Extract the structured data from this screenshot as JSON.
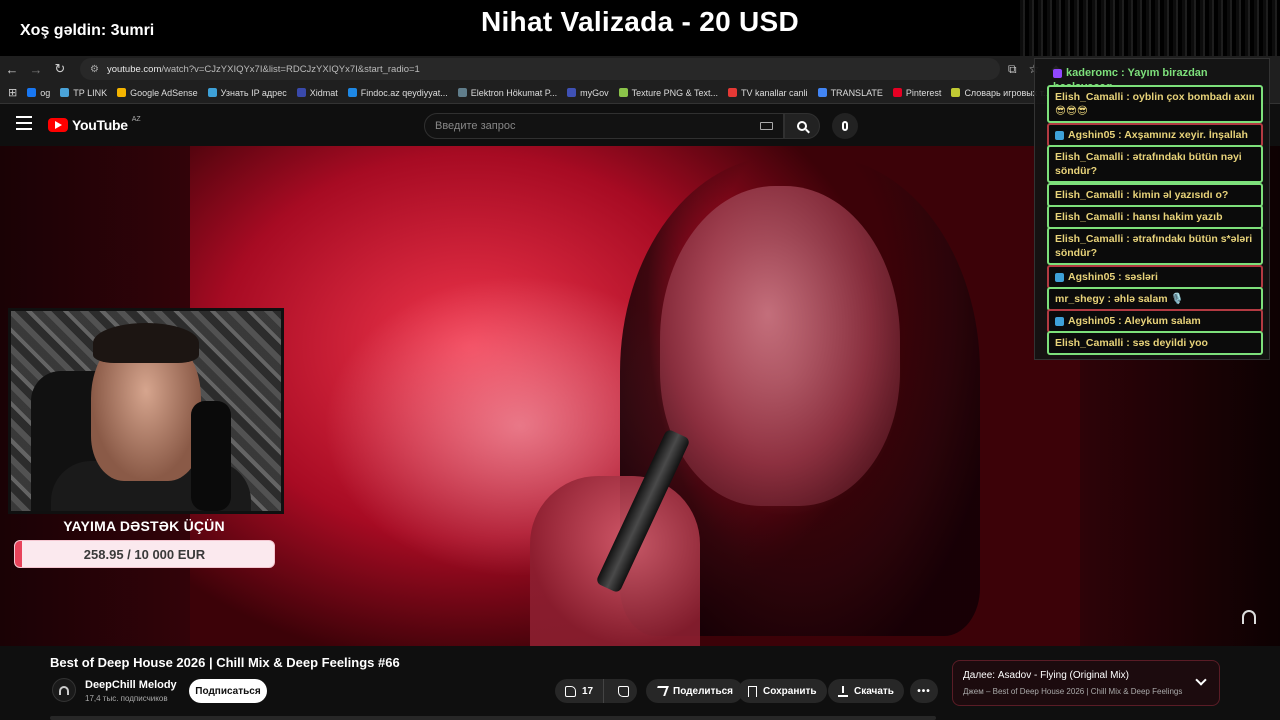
{
  "overlay": {
    "welcome": "Xoş gəldin: 3umri",
    "donation_headline": "Nihat Valizada - 20 USD",
    "support_title": "YAYIMA DƏSTƏK ÜÇÜN",
    "support_amount": "258.95 / 10 000 EUR",
    "support_progress": 0.0259,
    "accent_color": "#e8435b"
  },
  "browser": {
    "url_host": "youtube.com",
    "url_path": "/watch?v=CJzYXIQYx7I&list=RDCJzYXIQYx7I&start_radio=1",
    "bookmarks": [
      {
        "label": "og",
        "color": "#1877f2"
      },
      {
        "label": "TP LINK",
        "color": "#4aa3d9"
      },
      {
        "label": "Google AdSense",
        "color": "#f4b400"
      },
      {
        "label": "Узнать IP адрес",
        "color": "#3ea1d8"
      },
      {
        "label": "Xidmat",
        "color": "#3949ab"
      },
      {
        "label": "Findoc.az qeydiyyat...",
        "color": "#1e88e5"
      },
      {
        "label": "Elektron Hökumat P...",
        "color": "#607d8b"
      },
      {
        "label": "myGov",
        "color": "#3f51b5"
      },
      {
        "label": "Texture PNG & Text...",
        "color": "#8bc34a"
      },
      {
        "label": "TV kanallar canli",
        "color": "#e53935"
      },
      {
        "label": "TRANSLATE",
        "color": "#4285f4"
      },
      {
        "label": "Pinterest",
        "color": "#e60023"
      },
      {
        "label": "Словарь игровых т...",
        "color": "#c0ca33"
      }
    ]
  },
  "youtube": {
    "region": "AZ",
    "logo_text": "YouTube",
    "search_placeholder": "Введите запрос"
  },
  "chat": [
    {
      "platform": "twitch",
      "text": "kaderomc : Yayım birazdan başlayacaq.",
      "style": "first"
    },
    {
      "platform": "",
      "text": "Elish_Camalli : oyblin çox bombadı axııı 😎😎😎",
      "style": "green"
    },
    {
      "platform": "youtube",
      "text": "Agshin05 : Axşamınız xeyir. İnşallah",
      "style": "red"
    },
    {
      "platform": "",
      "text": "Elish_Camalli : ətrafındakı bütün nəyi söndür?",
      "style": "green"
    },
    {
      "platform": "",
      "text": "Elish_Camalli : kimin əl yazısıdı o?",
      "style": "green"
    },
    {
      "platform": "",
      "text": "Elish_Camalli : hansı hakim yazıb",
      "style": "green"
    },
    {
      "platform": "",
      "text": "Elish_Camalli : ətrafındakı bütün s*ələri söndür?",
      "style": "green"
    },
    {
      "platform": "youtube",
      "text": "Agshin05 : səsləri",
      "style": "red"
    },
    {
      "platform": "",
      "text": "mr_shegy : əhlə salam 🎙️",
      "style": "green"
    },
    {
      "platform": "youtube",
      "text": "Agshin05 : Aleykum salam",
      "style": "red"
    },
    {
      "platform": "",
      "text": "Elish_Camalli : səs deyildi yoo",
      "style": "green"
    }
  ],
  "video": {
    "title": "Best of Deep House 2026 | Chill Mix & Deep Feelings #66",
    "channel": "DeepChill Melody",
    "subscribers": "17,4 тыс. подписчиков",
    "subscribe_label": "Подписаться",
    "likes": "17",
    "share_label": "Поделиться",
    "save_label": "Сохранить",
    "download_label": "Скачать",
    "more_label": "•••"
  },
  "up_next": {
    "prefix": "Далее:",
    "title": "Asadov - Flying (Original Mix)",
    "subtitle": "Джем – Best of Deep House 2026 | Chill Mix & Deep Feelings"
  }
}
